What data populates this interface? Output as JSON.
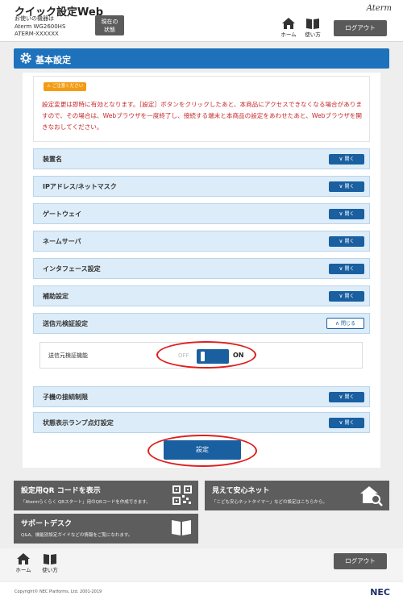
{
  "header": {
    "title": "クイック設定Web",
    "device_label": "お使いの機器は",
    "device_model": "Aterm WG2600HS",
    "device_id": "ATERM-XXXXXX",
    "status_button": "現在の\n状態",
    "brand": "Aterm",
    "home_label": "ホーム",
    "manual_label": "使い方",
    "logout_label": "ログアウト"
  },
  "section": {
    "title": "基本設定"
  },
  "notice": {
    "badge": "ご注意ください",
    "text": "設定変更は即時に有効となります。［設定］ボタンをクリックしたあと、本商品にアクセスできなくなる場合がありますので、その場合は、Webブラウザを一度終了し、接続する端末と本商品の設定をあわせたあと、Webブラウザを開きなおしてください。"
  },
  "accordion": {
    "open_label": "開く",
    "close_label": "閉じる",
    "items": [
      {
        "label": "装置名"
      },
      {
        "label": "IPアドレス/ネットマスク"
      },
      {
        "label": "ゲートウェイ"
      },
      {
        "label": "ネームサーバ"
      },
      {
        "label": "インタフェース設定"
      },
      {
        "label": "補助設定"
      },
      {
        "label": "送信元検証設定"
      },
      {
        "label": "子機の接続制限"
      },
      {
        "label": "状態表示ランプ点灯設定"
      }
    ]
  },
  "toggle_setting": {
    "label": "送信元検証機能",
    "off_label": "OFF",
    "on_label": "ON",
    "state": "on"
  },
  "submit_label": "設定",
  "tiles": {
    "qr": {
      "title": "設定用QR コードを表示",
      "desc": "「Atermらくらく QRスタート」用のQRコードを作成できます。"
    },
    "safety": {
      "title": "見えて安心ネット",
      "desc": "「こども安心ネットタイマー」などの設定はこちらから。"
    },
    "support": {
      "title": "サポートデスク",
      "desc": "Q&A、機能別設定ガイドなどの情報をご覧になれます。"
    }
  },
  "footer": {
    "home_label": "ホーム",
    "manual_label": "使い方",
    "logout_label": "ログアウト",
    "copyright": "Copyright© NEC Platforms, Ltd. 2001-2019",
    "nec_logo": "NEC"
  },
  "colors": {
    "accent": "#1e72bb",
    "row_bg": "#dcecf8",
    "warning": "#c62828",
    "badge": "#f39c12",
    "tile": "#5d5d5d"
  }
}
